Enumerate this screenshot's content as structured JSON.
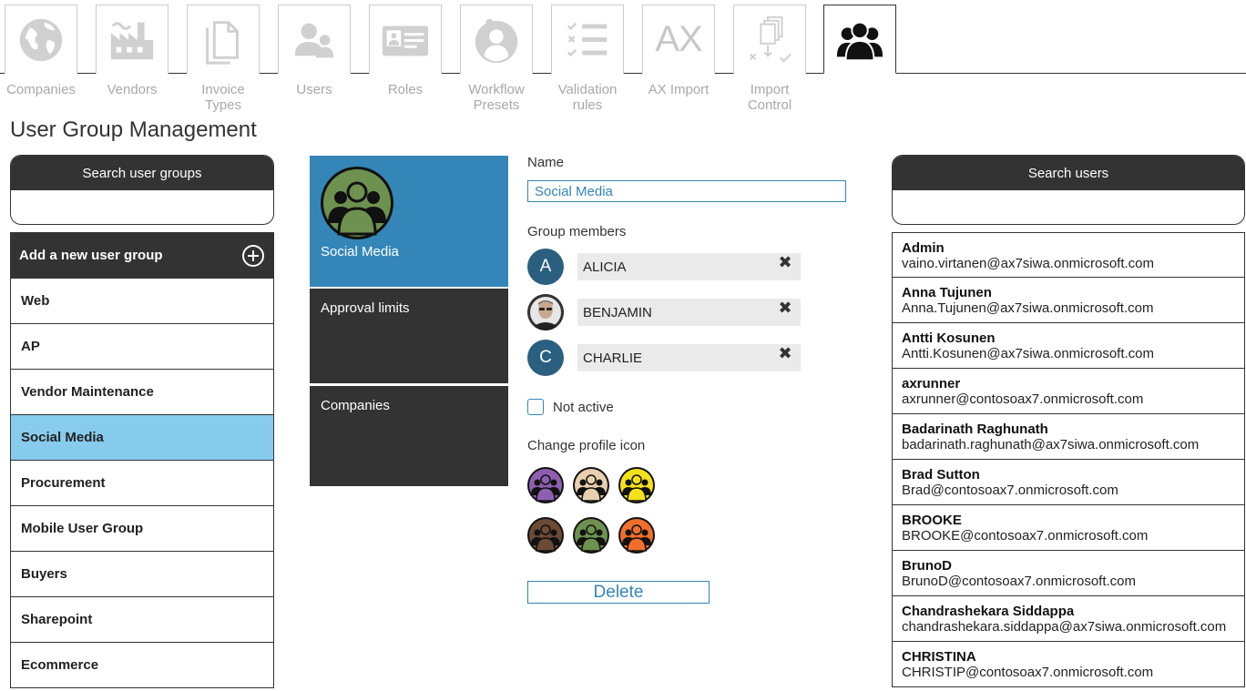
{
  "nav": {
    "items": [
      {
        "label": "Companies",
        "icon": "globe-icon"
      },
      {
        "label": "Vendors",
        "icon": "factory-icon"
      },
      {
        "label": "Invoice\nTypes",
        "icon": "documents-icon"
      },
      {
        "label": "Users",
        "icon": "users-icon"
      },
      {
        "label": "Roles",
        "icon": "id-card-icon"
      },
      {
        "label": "Workflow\nPresets",
        "icon": "person-circle-icon"
      },
      {
        "label": "Validation\nrules",
        "icon": "checklist-icon"
      },
      {
        "label": "AX Import",
        "icon": "ax-icon",
        "text": "AX"
      },
      {
        "label": "Import\nControl",
        "icon": "import-control-icon"
      },
      {
        "label": "",
        "icon": "user-group-icon",
        "active": true
      }
    ]
  },
  "page": {
    "title": "User Group Management"
  },
  "groups_panel": {
    "search_label": "Search user groups",
    "search_value": "",
    "add_label": "Add a new user group",
    "items": [
      "Web",
      "AP",
      "Vendor Maintenance",
      "Social Media",
      "Procurement",
      "Mobile User Group",
      "Buyers",
      "Sharepoint",
      "Ecommerce"
    ],
    "selected": "Social Media"
  },
  "group_detail": {
    "card_name": "Social Media",
    "approval_limits": "Approval limits",
    "companies": "Companies",
    "name_label": "Name",
    "name_value": "Social Media",
    "members_label": "Group members",
    "members": [
      {
        "initial": "A",
        "name": "ALICIA",
        "photo": false
      },
      {
        "initial": "",
        "name": "BENJAMIN",
        "photo": true
      },
      {
        "initial": "C",
        "name": "CHARLIE",
        "photo": false
      }
    ],
    "not_active_label": "Not active",
    "change_icon_label": "Change profile icon",
    "icon_colors": [
      "#8e5fb0",
      "#e8cfae",
      "#f5e11a",
      "#6b4a36",
      "#6e9150",
      "#f06f2a"
    ],
    "card_icon_color": "#6e9150",
    "delete_label": "Delete"
  },
  "users_panel": {
    "search_label": "Search users",
    "search_value": "",
    "items": [
      {
        "name": "Admin",
        "email": "vaino.virtanen@ax7siwa.onmicrosoft.com"
      },
      {
        "name": "Anna Tujunen",
        "email": "Anna.Tujunen@ax7siwa.onmicrosoft.com"
      },
      {
        "name": "Antti Kosunen",
        "email": "Antti.Kosunen@ax7siwa.onmicrosoft.com"
      },
      {
        "name": "axrunner",
        "email": "axrunner@contosoax7.onmicrosoft.com"
      },
      {
        "name": "Badarinath Raghunath",
        "email": "badarinath.raghunath@ax7siwa.onmicrosoft.com"
      },
      {
        "name": "Brad Sutton",
        "email": "Brad@contosoax7.onmicrosoft.com"
      },
      {
        "name": "BROOKE",
        "email": "BROOKE@contosoax7.onmicrosoft.com"
      },
      {
        "name": "BrunoD",
        "email": "BrunoD@contosoax7.onmicrosoft.com"
      },
      {
        "name": "Chandrashekara Siddappa",
        "email": "chandrashekara.siddappa@ax7siwa.onmicrosoft.com"
      },
      {
        "name": "CHRISTINA",
        "email": "CHRISTIP@contosoax7.onmicrosoft.com"
      }
    ]
  }
}
